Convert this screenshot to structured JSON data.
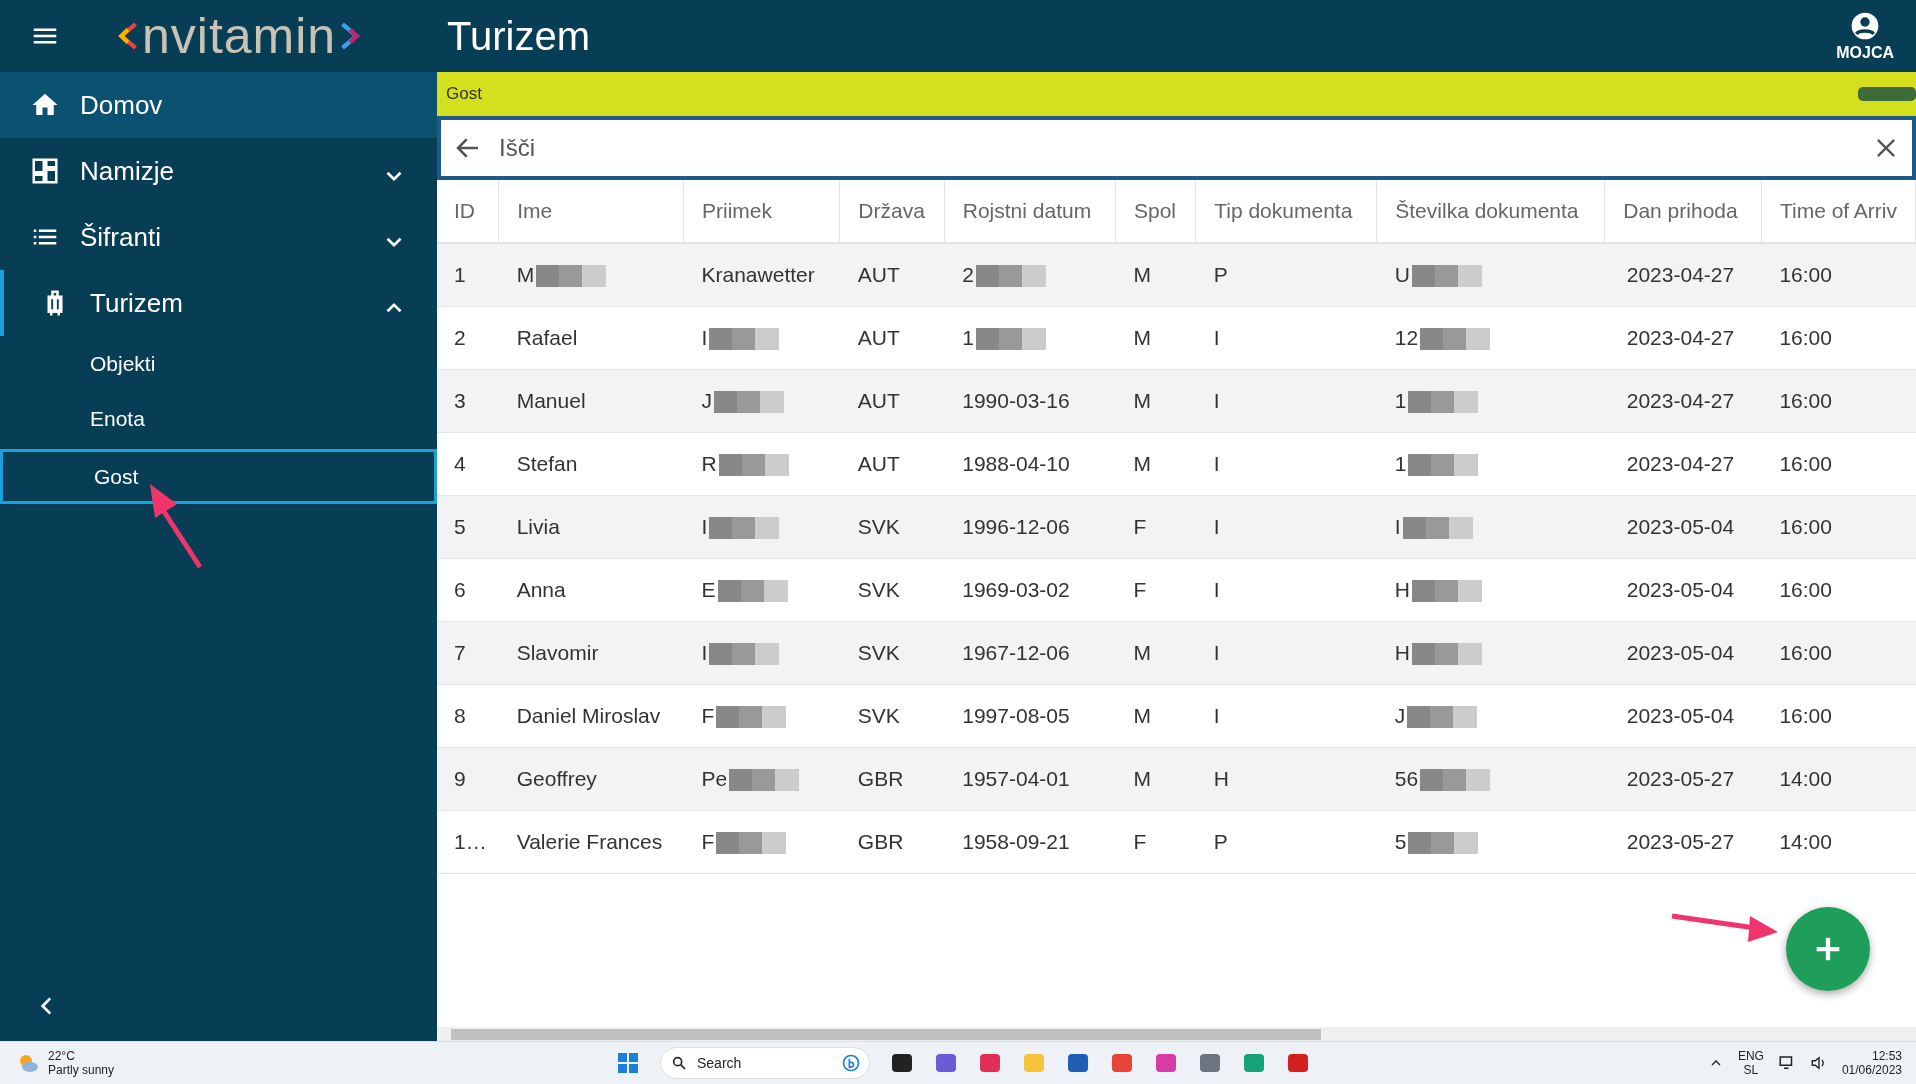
{
  "app": {
    "logo": "nvitamin",
    "title": "Turizem",
    "user": "MOJCA"
  },
  "sidebar": {
    "items": [
      {
        "label": "Domov",
        "active": true
      },
      {
        "label": "Namizje",
        "active": false,
        "expanded": false
      },
      {
        "label": "Šifranti",
        "active": false,
        "expanded": false
      },
      {
        "label": "Turizem",
        "active": false,
        "expanded": true,
        "children": [
          {
            "label": "Objekti",
            "selected": false
          },
          {
            "label": "Enota",
            "selected": false
          },
          {
            "label": "Gost",
            "selected": true
          }
        ]
      }
    ]
  },
  "breadcrumb": "Gost",
  "search": {
    "placeholder": "Išči"
  },
  "table": {
    "columns": [
      "ID",
      "Ime",
      "Priimek",
      "Država",
      "Rojstni datum",
      "Spol",
      "Tip dokumenta",
      "Številka dokumenta",
      "Dan prihoda",
      "Time of Arriv"
    ],
    "rows": [
      {
        "cells": [
          "1",
          {
            "text": "M",
            "redacted": true
          },
          "Kranawetter",
          "AUT",
          {
            "text": "2",
            "redacted": true
          },
          "M",
          "P",
          {
            "text": "U",
            "redacted": true
          },
          "2023-04-27",
          "16:00"
        ]
      },
      {
        "cells": [
          "2",
          "Rafael",
          {
            "text": "I",
            "redacted": true
          },
          "AUT",
          {
            "text": "1",
            "redacted": true
          },
          "M",
          "I",
          {
            "text": "12",
            "redacted": true
          },
          "2023-04-27",
          "16:00"
        ]
      },
      {
        "cells": [
          "3",
          "Manuel",
          {
            "text": "J",
            "redacted": true
          },
          "AUT",
          "1990-03-16",
          "M",
          "I",
          {
            "text": "1",
            "redacted": true
          },
          "2023-04-27",
          "16:00"
        ]
      },
      {
        "cells": [
          "4",
          "Stefan",
          {
            "text": "R",
            "redacted": true
          },
          "AUT",
          "1988-04-10",
          "M",
          "I",
          {
            "text": "1",
            "redacted": true
          },
          "2023-04-27",
          "16:00"
        ]
      },
      {
        "cells": [
          "5",
          "Livia",
          {
            "text": "I",
            "redacted": true
          },
          "SVK",
          "1996-12-06",
          "F",
          "I",
          {
            "text": "I",
            "redacted": true
          },
          "2023-05-04",
          "16:00"
        ]
      },
      {
        "cells": [
          "6",
          "Anna",
          {
            "text": "E",
            "redacted": true
          },
          "SVK",
          "1969-03-02",
          "F",
          "I",
          {
            "text": "H",
            "redacted": true
          },
          "2023-05-04",
          "16:00"
        ]
      },
      {
        "cells": [
          "7",
          "Slavomir",
          {
            "text": "I",
            "redacted": true
          },
          "SVK",
          "1967-12-06",
          "M",
          "I",
          {
            "text": "H",
            "redacted": true
          },
          "2023-05-04",
          "16:00"
        ]
      },
      {
        "cells": [
          "8",
          "Daniel Miroslav",
          {
            "text": "F",
            "redacted": true
          },
          "SVK",
          "1997-08-05",
          "M",
          "I",
          {
            "text": "J",
            "redacted": true
          },
          "2023-05-04",
          "16:00"
        ]
      },
      {
        "cells": [
          "9",
          "Geoffrey",
          {
            "text": "Pe",
            "redacted": true
          },
          "GBR",
          "1957-04-01",
          "M",
          "H",
          {
            "text": "56",
            "redacted": true
          },
          "2023-05-27",
          "14:00"
        ]
      },
      {
        "cells": [
          "1…",
          "Valerie Frances",
          {
            "text": "F",
            "redacted": true
          },
          "GBR",
          "1958-09-21",
          "F",
          "P",
          {
            "text": "5",
            "redacted": true
          },
          "2023-05-27",
          "14:00"
        ]
      }
    ]
  },
  "taskbar": {
    "weather": {
      "temp": "22°C",
      "desc": "Partly sunny"
    },
    "search": "Search",
    "lang": [
      "ENG",
      "SL"
    ],
    "time": "12:53",
    "date": "01/06/2023"
  }
}
